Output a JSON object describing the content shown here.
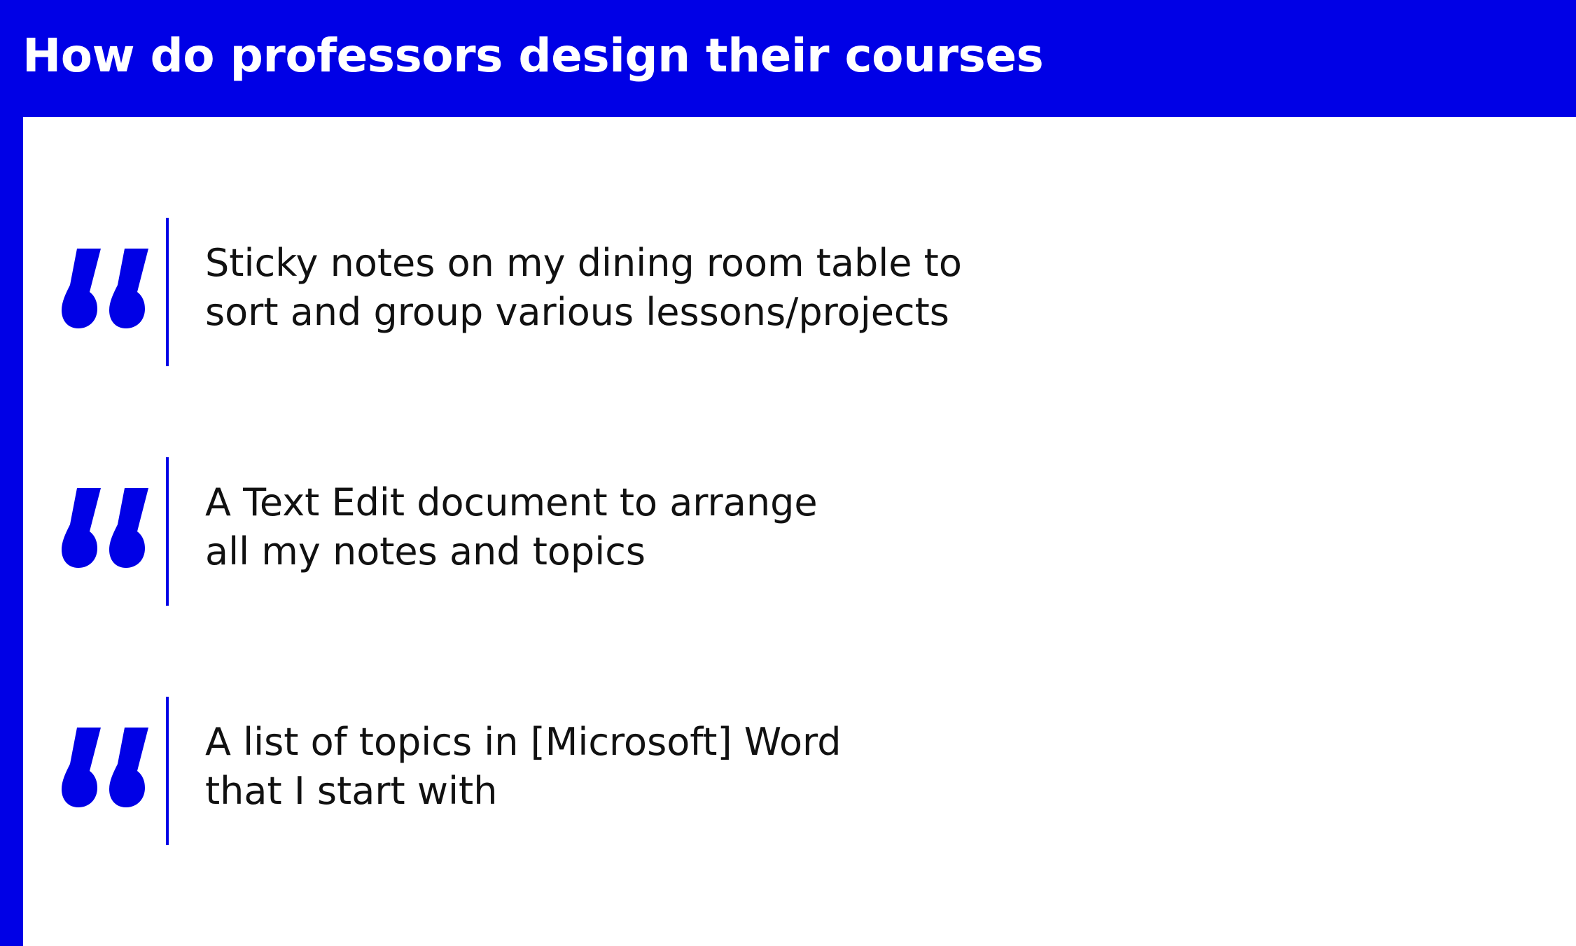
{
  "header": {
    "title": "How do professors design their courses"
  },
  "colors": {
    "accent": "#0000e6",
    "text": "#111111",
    "background": "#ffffff"
  },
  "quotes": [
    {
      "icon": "quote-mark-icon",
      "lines": [
        "Sticky notes on my dining room table to",
        "sort and group various lessons/projects"
      ]
    },
    {
      "icon": "quote-mark-icon",
      "lines": [
        "A Text Edit document to arrange",
        "all my notes and topics"
      ]
    },
    {
      "icon": "quote-mark-icon",
      "lines": [
        "A list of topics in [Microsoft] Word",
        "that I start with"
      ]
    }
  ]
}
